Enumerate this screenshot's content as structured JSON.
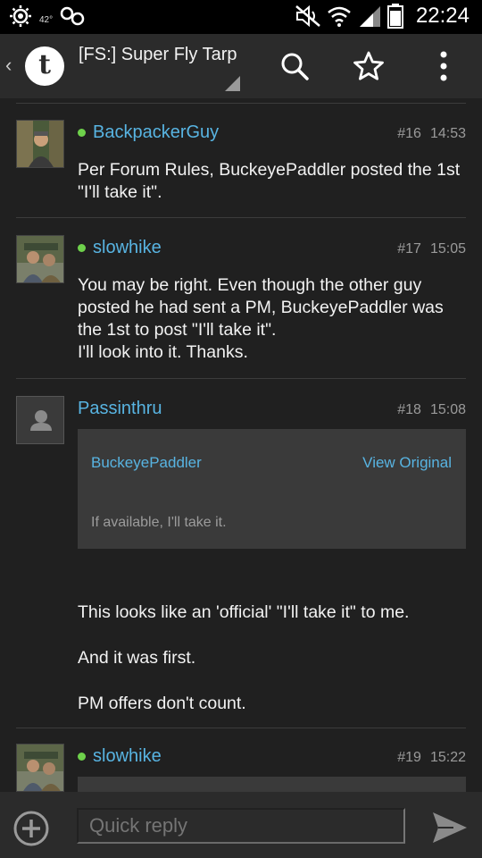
{
  "status_bar": {
    "temperature": "42°",
    "clock": "22:24",
    "icons": [
      "weather-icon",
      "voicemail-icon",
      "mute-icon",
      "wifi-icon",
      "signal-icon",
      "battery-icon"
    ]
  },
  "action_bar": {
    "back_glyph": "‹",
    "logo_letter": "t",
    "title": "[FS:] Super Fly Tarp",
    "icons": [
      "search-icon",
      "star-icon",
      "overflow-menu-icon"
    ]
  },
  "posts": [
    {
      "author": "BackpackerGuy",
      "online": true,
      "number": "#16",
      "time": "14:53",
      "body": [
        "Per Forum Rules, BuckeyePaddler posted the 1st \"I'll take it\"."
      ]
    },
    {
      "author": "slowhike",
      "online": true,
      "number": "#17",
      "time": "15:05",
      "body": [
        "You may be right. Even though the other guy posted he had sent a PM, BuckeyePaddler was the 1st to post \"I'll take it\".",
        "I'll look into it. Thanks."
      ]
    },
    {
      "author": "Passinthru",
      "online": false,
      "number": "#18",
      "time": "15:08",
      "quote": {
        "author": "BuckeyePaddler",
        "view_label": "View Original",
        "text": "If available, I'll take it."
      },
      "body": [
        "This looks like an 'official' \"I'll take it\" to me.",
        "And it was first.",
        "PM offers don't count."
      ]
    },
    {
      "author": "slowhike",
      "online": true,
      "number": "#19",
      "time": "15:22"
    }
  ],
  "reply_bar": {
    "placeholder": "Quick reply",
    "icons": [
      "add-attachment-icon",
      "send-icon"
    ]
  },
  "colors": {
    "accent_blue": "#58b4e2",
    "online_green": "#6ed14b",
    "background": "#202020",
    "bar": "#2b2b2b"
  }
}
